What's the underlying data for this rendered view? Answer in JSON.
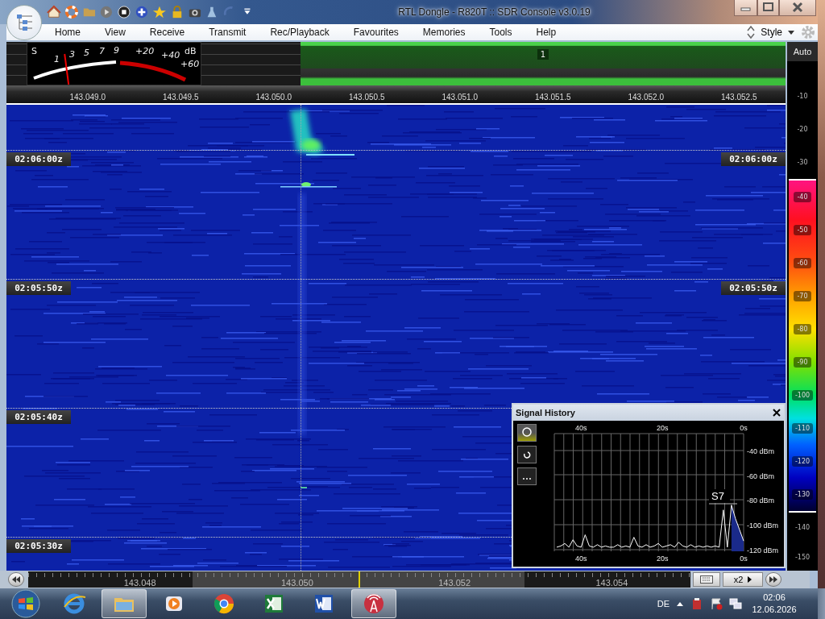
{
  "window": {
    "title": "RTL Dongle - R820T :: SDR Console v3.0.19"
  },
  "menu": [
    {
      "label": "Home"
    },
    {
      "label": "View"
    },
    {
      "label": "Receive"
    },
    {
      "label": "Transmit"
    },
    {
      "label": "Rec/Playback"
    },
    {
      "label": "Favourites"
    },
    {
      "label": "Memories"
    },
    {
      "label": "Tools"
    },
    {
      "label": "Help"
    }
  ],
  "style_menu": {
    "label": "Style"
  },
  "s_meter": {
    "unit_s": "S",
    "unit_db": "dB",
    "s_scale": [
      "1",
      "3",
      "5",
      "7",
      "9"
    ],
    "db_scale": [
      "+20",
      "+40",
      "+60"
    ],
    "level": 0.19
  },
  "spectrum": {
    "channel_label": "1",
    "frequency_ticks": [
      "143.049.0",
      "143.049.5",
      "143.050.0",
      "143.050.5",
      "143.051.0",
      "143.051.5",
      "143.052.0",
      "143.052.5"
    ]
  },
  "level_scale": {
    "mode": "Auto",
    "labels_above": [
      "-10",
      "-20",
      "-30"
    ],
    "color_bar": [
      "-40",
      "-50",
      "-60",
      "-70",
      "-80",
      "-90",
      "-100",
      "-110",
      "-120",
      "-130"
    ],
    "labels_below": [
      "-140",
      "-150"
    ]
  },
  "waterfall": {
    "time_marks": [
      {
        "left": "02:06:00z",
        "right": "02:06:00z"
      },
      {
        "left": "02:05:50z",
        "right": "02:05:50z"
      },
      {
        "left": "02:05:40z"
      },
      {
        "left": "02:05:30z"
      }
    ]
  },
  "signal_history": {
    "title": "Signal History",
    "top_ticks": [
      "40s",
      "20s",
      "0s"
    ],
    "reading": "S7",
    "chart_data": {
      "type": "line",
      "grid": true,
      "xlim": [
        46.6,
        0
      ],
      "ylim": [
        -120,
        -26.5
      ],
      "xticks": [
        {
          "value": 40,
          "label": "40s"
        },
        {
          "value": 20,
          "label": "20s"
        },
        {
          "value": 0,
          "label": "0s"
        }
      ],
      "yticks": [
        {
          "value": -40,
          "label": "-40 dBm"
        },
        {
          "value": -60,
          "label": "-60 dBm"
        },
        {
          "value": -80,
          "label": "-80 dBm"
        },
        {
          "value": -100,
          "label": "-100 dBm"
        },
        {
          "value": -120,
          "label": "-120 dBm"
        }
      ],
      "x": [
        46,
        45,
        44,
        43,
        42,
        41,
        40,
        39,
        38,
        37,
        36,
        35,
        34,
        33,
        32,
        31,
        30,
        29,
        28,
        27,
        26,
        25,
        24,
        23,
        22,
        21,
        20,
        19,
        18,
        17,
        16,
        15,
        14,
        13,
        12,
        11,
        10,
        9,
        8,
        7,
        6,
        5,
        4,
        3,
        2,
        1,
        0
      ],
      "series": [
        {
          "color": "#ffffff",
          "values": [
            -118,
            -117,
            -115,
            -118,
            -112,
            -117,
            -118,
            -108,
            -117,
            -118,
            -116,
            -118,
            -117,
            -118,
            -118,
            -116,
            -118,
            -117,
            -118,
            -110,
            -117,
            -118,
            -116,
            -118,
            -117,
            -115,
            -118,
            -117,
            -116,
            -118,
            -114,
            -117,
            -118,
            -116,
            -118,
            -117,
            -118,
            -117,
            -118,
            -117,
            -118,
            -88,
            -118,
            -84,
            -95,
            -104,
            -113
          ]
        }
      ]
    }
  },
  "frequency_bar": {
    "ticks": [
      "143.048",
      "143.050",
      "143.052",
      "143.054"
    ],
    "zoom": "x2"
  },
  "taskbar": {
    "apps": [
      {
        "kind": "browser",
        "selected": false
      },
      {
        "kind": "folder",
        "selected": true
      },
      {
        "kind": "media",
        "selected": false
      },
      {
        "kind": "chrome",
        "selected": false
      },
      {
        "kind": "sheet",
        "selected": false
      },
      {
        "kind": "doc",
        "selected": false
      },
      {
        "kind": "radio",
        "selected": true
      }
    ],
    "language": "DE",
    "time": "02:06",
    "date": "12.06.2026"
  }
}
